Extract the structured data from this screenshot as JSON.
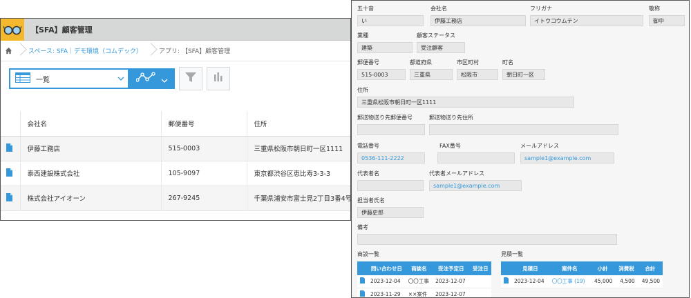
{
  "app": {
    "title": "【SFA】顧客管理",
    "breadcrumb": [
      "スペース: SFA｜デモ環境（コムデック）",
      "アプリ: 【SFA】顧客管理"
    ]
  },
  "toolbar": {
    "view_label": "一覧"
  },
  "list": {
    "columns": [
      "会社名",
      "郵便番号",
      "住所"
    ],
    "rows": [
      {
        "company": "伊藤工務店",
        "zip": "515-0003",
        "address": "三重県松阪市朝日町一区1111"
      },
      {
        "company": "泰西建設株式会社",
        "zip": "105-9097",
        "address": "東京都渋谷区恵比寿3-3-3"
      },
      {
        "company": "株式会社アイオーン",
        "zip": "267-9245",
        "address": "千葉県浦安市富士見2丁目3番4号"
      }
    ]
  },
  "detail": {
    "gojuon": {
      "label": "五十音",
      "value": "い"
    },
    "company": {
      "label": "会社名",
      "value": "伊藤工務店"
    },
    "furigana": {
      "label": "フリガナ",
      "value": "イトウコウムテン"
    },
    "honorific": {
      "label": "敬称",
      "value": "御中"
    },
    "industry": {
      "label": "業種",
      "value": "建築"
    },
    "status": {
      "label": "顧客ステータス",
      "value": "受注顧客"
    },
    "zip": {
      "label": "郵便番号",
      "value": "515-0003"
    },
    "pref": {
      "label": "都道府県",
      "value": "三重県"
    },
    "city": {
      "label": "市区町村",
      "value": "松阪市"
    },
    "town": {
      "label": "町名",
      "value": "朝日町一区"
    },
    "address": {
      "label": "住所",
      "value": "三重県松阪市朝日町一区1111"
    },
    "ship_zip": {
      "label": "郵送物送り先郵便番号",
      "value": ""
    },
    "ship_addr": {
      "label": "郵送物送り先住所",
      "value": ""
    },
    "phone": {
      "label": "電話番号",
      "value": "0536-111-2222"
    },
    "fax": {
      "label": "FAX番号",
      "value": ""
    },
    "email": {
      "label": "メールアドレス",
      "value": "sample1@example.com"
    },
    "rep": {
      "label": "代表者名",
      "value": ""
    },
    "rep_email": {
      "label": "代表者メールアドレス",
      "value": "sample1@example.com"
    },
    "owner": {
      "label": "担当者氏名",
      "value": "伊藤史郎"
    },
    "notes": {
      "label": "備考",
      "value": ""
    },
    "deals": {
      "label": "商談一覧",
      "columns": [
        "問い合わせ日",
        "商談名",
        "受注予定日",
        "受注日"
      ],
      "rows": [
        [
          "2023-12-04",
          "〇〇工事",
          "2023-12-07",
          ""
        ],
        [
          "2023-11-29",
          "××案件",
          "2023-12-07",
          ""
        ]
      ]
    },
    "quotes": {
      "label": "見積一覧",
      "columns": [
        "見積日",
        "案件名",
        "小計",
        "消費税",
        "合計"
      ],
      "rows": [
        [
          "2023-12-04",
          "〇〇工事 (19)",
          "45,000",
          "4,500",
          "49,500"
        ]
      ]
    }
  },
  "colors": {
    "accent": "#3498db",
    "app_icon": "#f4b82e"
  }
}
